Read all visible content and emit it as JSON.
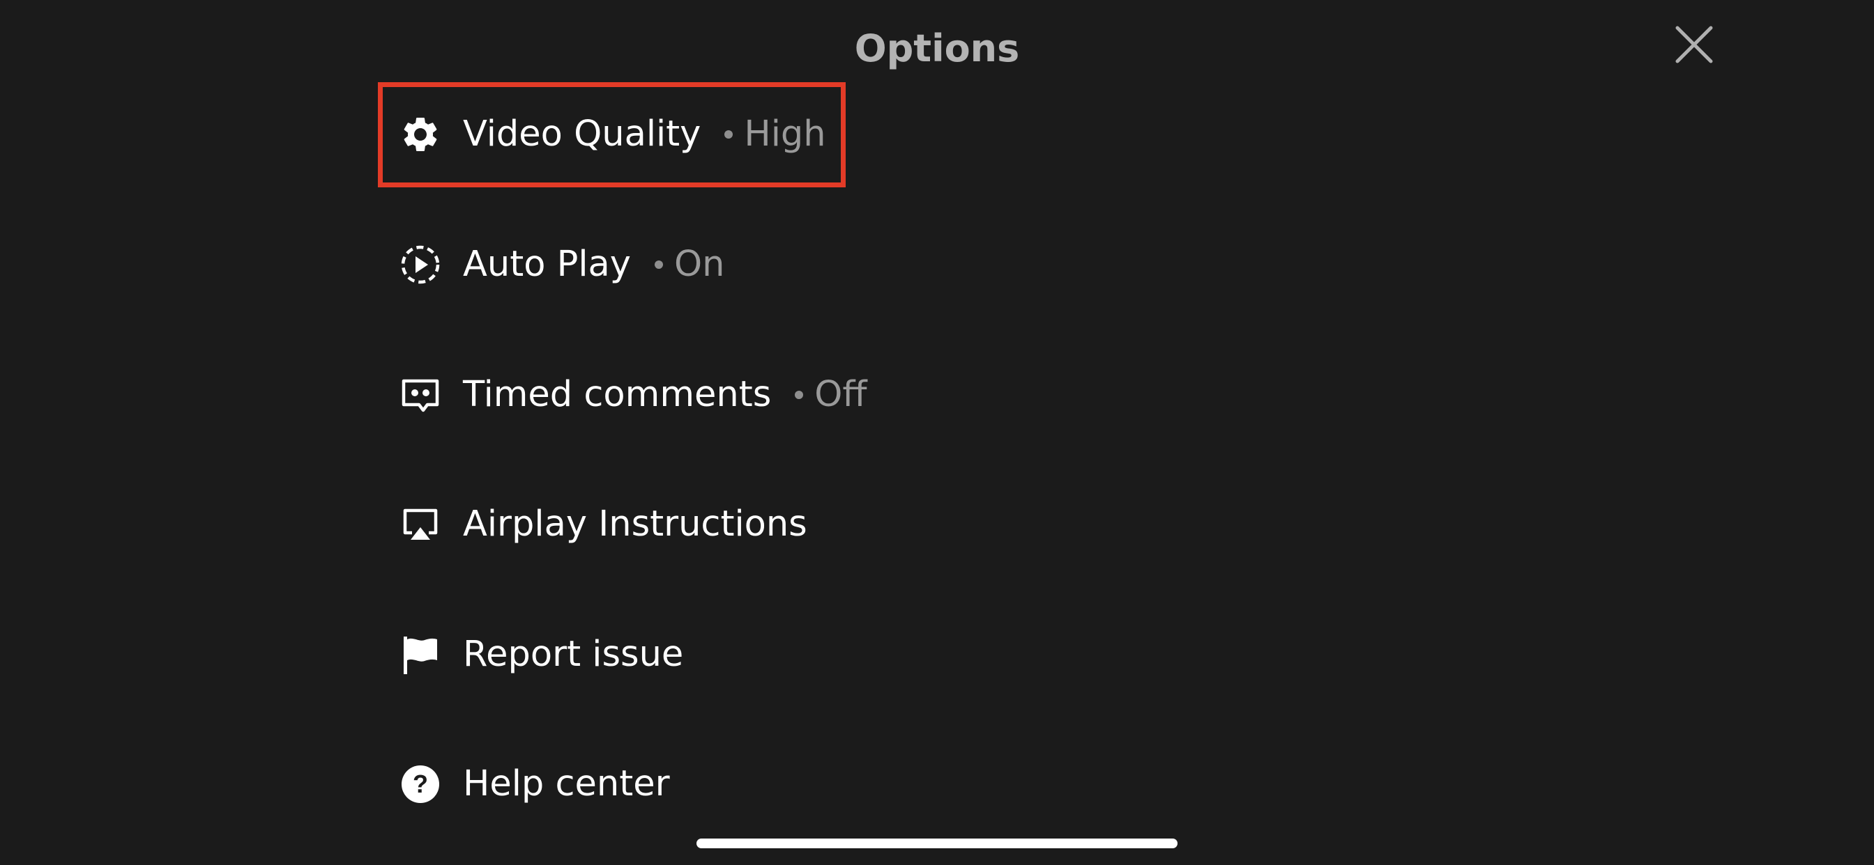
{
  "header": {
    "title": "Options"
  },
  "menu": {
    "items": [
      {
        "id": "video-quality",
        "label": "Video Quality",
        "value": "High",
        "icon": "gear-icon"
      },
      {
        "id": "auto-play",
        "label": "Auto Play",
        "value": "On",
        "icon": "autoplay-icon"
      },
      {
        "id": "timed-comments",
        "label": "Timed comments",
        "value": "Off",
        "icon": "comment-icon"
      },
      {
        "id": "airplay",
        "label": "Airplay Instructions",
        "value": "",
        "icon": "airplay-icon"
      },
      {
        "id": "report-issue",
        "label": "Report issue",
        "value": "",
        "icon": "flag-icon"
      },
      {
        "id": "help-center",
        "label": "Help center",
        "value": "",
        "icon": "help-icon"
      }
    ]
  },
  "colors": {
    "background": "#1b1b1b",
    "highlight": "#e33b27",
    "text": "#ffffff",
    "muted": "#9a9a9a"
  }
}
